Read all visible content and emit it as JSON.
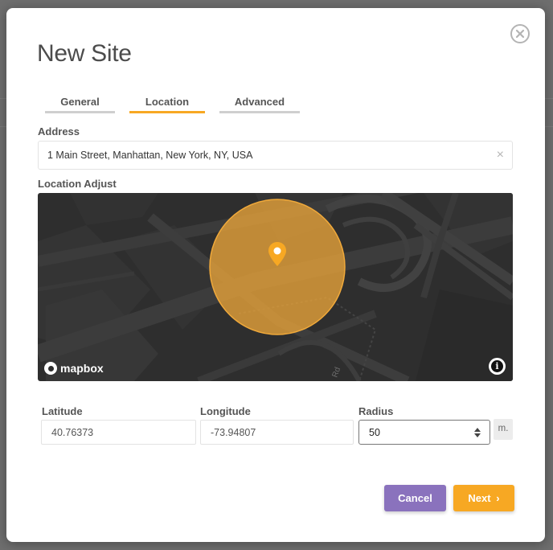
{
  "modal": {
    "title": "New Site",
    "close_icon": "close-circle-icon"
  },
  "tabs": [
    {
      "label": "General",
      "active": false
    },
    {
      "label": "Location",
      "active": true
    },
    {
      "label": "Advanced",
      "active": false
    }
  ],
  "address": {
    "label": "Address",
    "value": "1 Main Street, Manhattan, New York, NY, USA",
    "clear_label": "×"
  },
  "map": {
    "label": "Location Adjust",
    "attribution_logo": "mapbox",
    "road_label": "Rd",
    "marker_icon": "map-pin-icon",
    "info_icon": "info-icon",
    "info_glyph": "i"
  },
  "latitude": {
    "label": "Latitude",
    "value": "40.76373"
  },
  "longitude": {
    "label": "Longitude",
    "value": "-73.94807"
  },
  "radius": {
    "label": "Radius",
    "value": "50",
    "unit": "m."
  },
  "buttons": {
    "cancel": "Cancel",
    "next": "Next",
    "next_chevron": "›"
  },
  "colors": {
    "accent": "#f7a823",
    "cancel": "#8a72bd",
    "map_background": "#2e2e2e"
  }
}
